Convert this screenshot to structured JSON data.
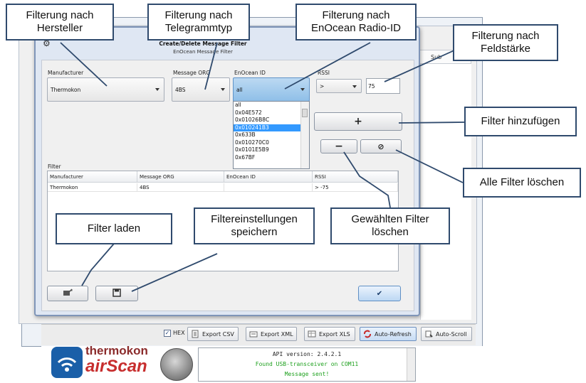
{
  "background_window": {
    "table_header": "Sub",
    "toolbar": {
      "hex_label": "HEX",
      "export_csv": "Export CSV",
      "export_xml": "Export XML",
      "export_xls": "Export XLS",
      "auto_refresh": "Auto-Refresh",
      "auto_scroll": "Auto-Scroll"
    },
    "logo": {
      "brand": "thermokon",
      "product": "airScan"
    },
    "console": [
      "API version: 2.4.2.1",
      "Found USB-transceiver on COM11",
      "Message sent!"
    ]
  },
  "dialog": {
    "title": "Create/Delete Message Filter",
    "subtitle": "EnOcean Message Filter",
    "fields": {
      "manufacturer_label": "Manufacturer",
      "manufacturer_value": "Thermokon",
      "message_org_label": "Message ORG",
      "message_org_value": "4BS",
      "enocean_id_label": "EnOcean ID",
      "enocean_id_value": "all",
      "rssi_label": "RSSI",
      "rssi_operator": ">",
      "rssi_value": "75"
    },
    "enocean_id_options": [
      "all",
      "0x04E572",
      "0x01026B8C",
      "0x010241B3",
      "0x633B",
      "0x010270C0",
      "0x0101E5B9",
      "0x67BF"
    ],
    "enocean_id_selected": "0x010241B3",
    "add_button": "+",
    "remove_button": "−",
    "clear_button": "⊘",
    "filter_label": "Filter",
    "filter_table": {
      "columns": [
        "Manufacturer",
        "Message ORG",
        "EnOcean ID",
        "RSSI"
      ],
      "rows": [
        [
          "Thermokon",
          "4BS",
          "",
          "> -75"
        ]
      ]
    },
    "ok_button": "✔"
  },
  "callouts": {
    "manufacturer": [
      "Filterung nach",
      "Hersteller"
    ],
    "telegram_type": [
      "Filterung nach",
      "Telegrammtyp"
    ],
    "radio_id": [
      "Filterung nach",
      "EnOcean Radio-ID"
    ],
    "field_strength": [
      "Filterung nach",
      "Feldstärke"
    ],
    "add_filter": [
      "Filter hinzufügen"
    ],
    "delete_all": [
      "Alle Filter löschen"
    ],
    "delete_selected": [
      "Gewählten Filter",
      "löschen"
    ],
    "load_filter": [
      "Filter laden"
    ],
    "save_settings": [
      "Filtereinstellungen",
      "speichern"
    ]
  }
}
